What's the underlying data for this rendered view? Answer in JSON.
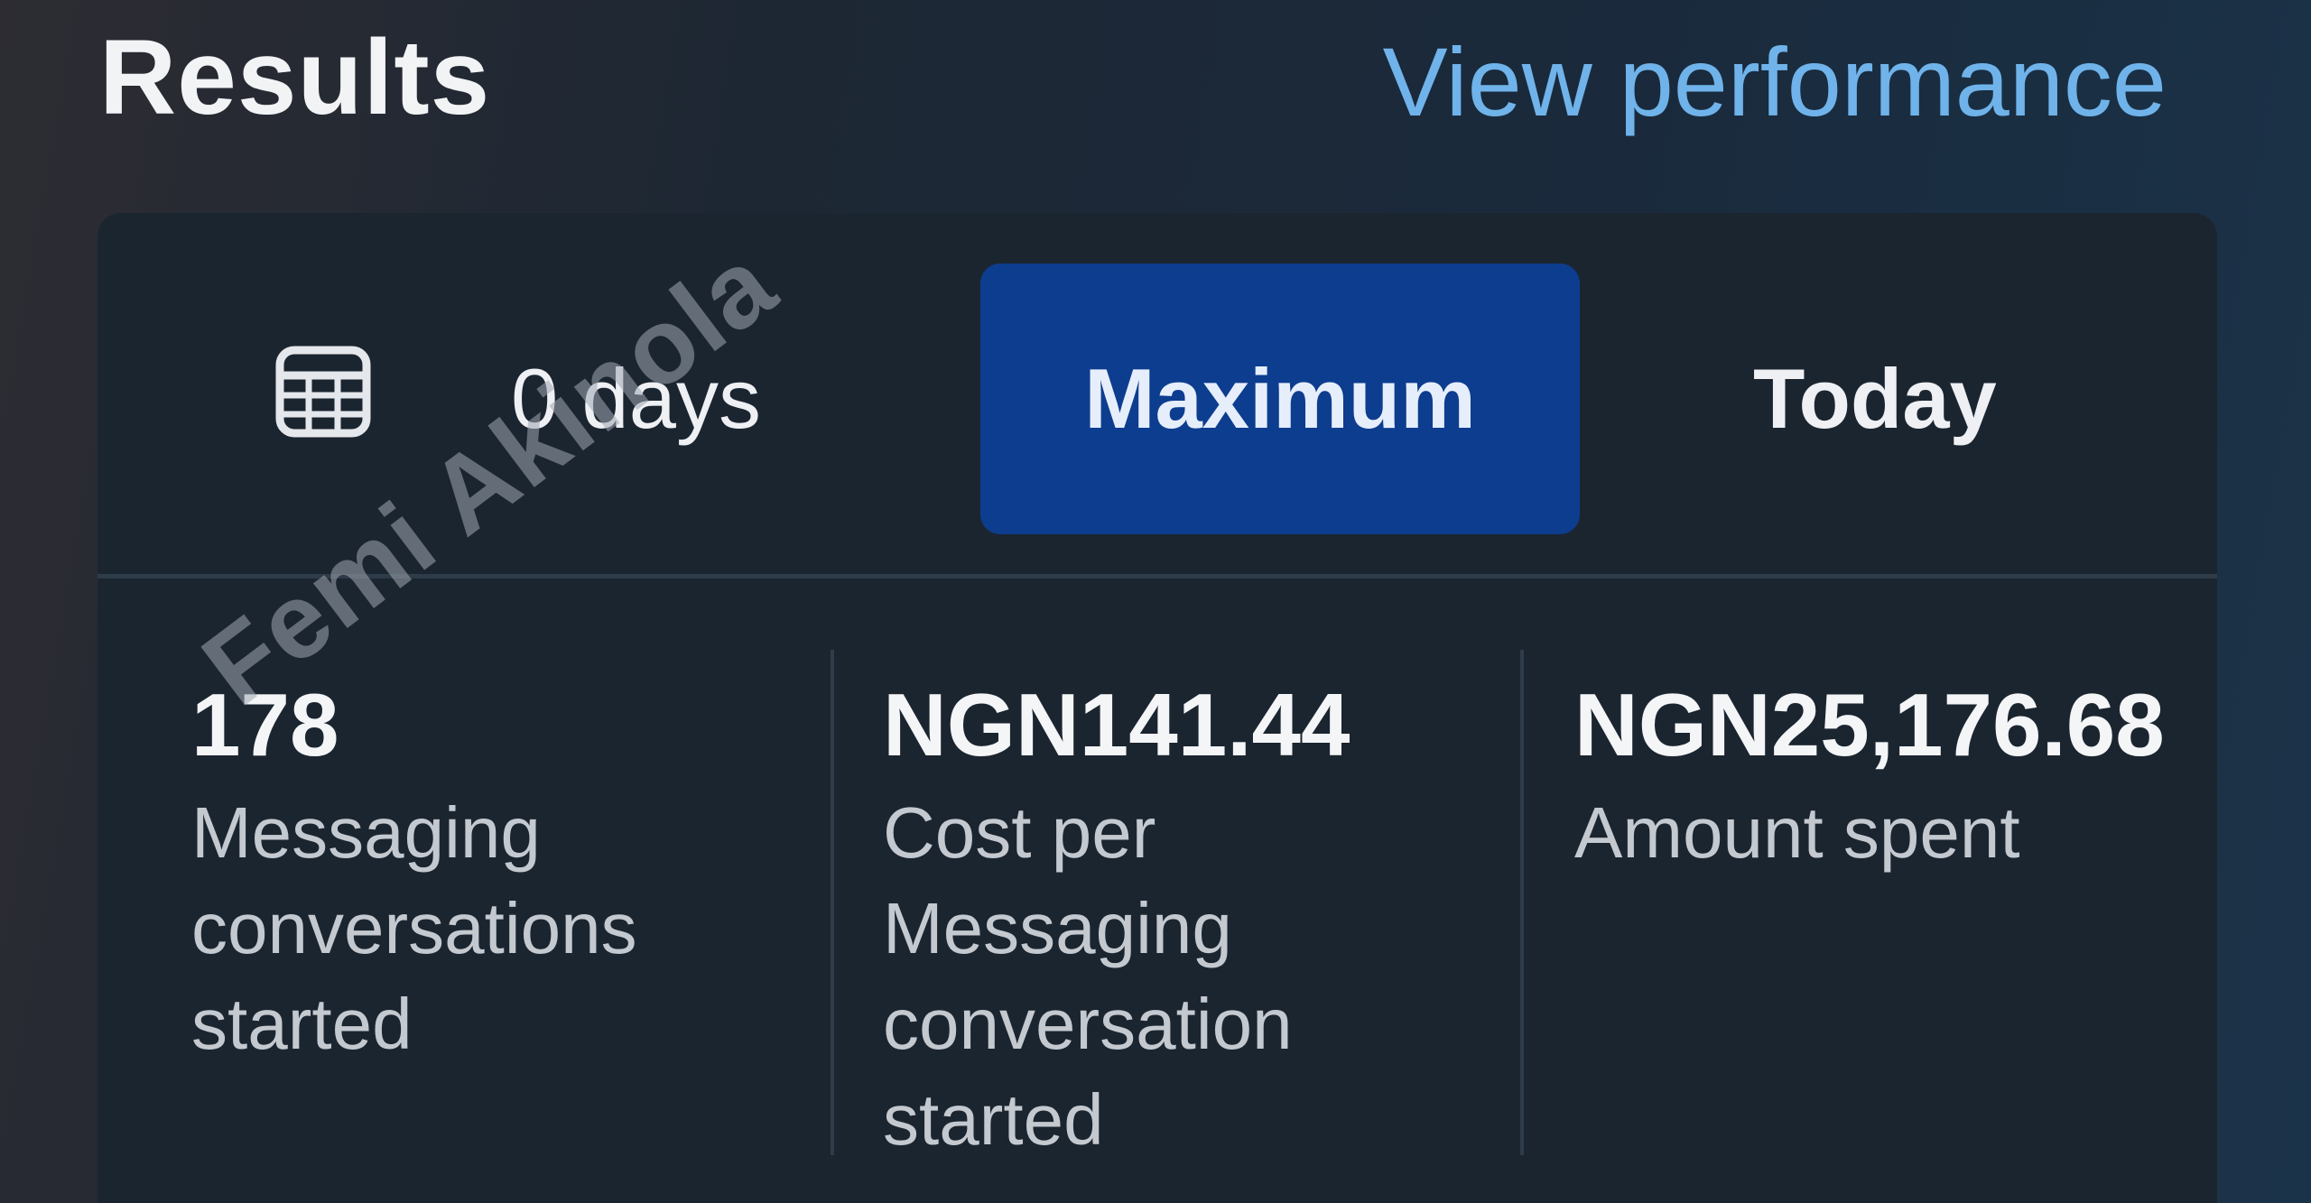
{
  "header": {
    "title": "Results",
    "link_label": "View performance"
  },
  "date_range": {
    "calendar_icon": "calendar-icon",
    "days_label": "0 days",
    "selected_option": "Maximum",
    "other_option": "Today",
    "accent_color": "#0d3d8f"
  },
  "metrics": [
    {
      "value": "178",
      "label": "Messaging conversations started"
    },
    {
      "value": "NGN141.44",
      "label": "Cost per Messaging conversation started"
    },
    {
      "value": "NGN25,176.68",
      "label": "Amount spent"
    }
  ],
  "watermark": "Femi Akinola"
}
